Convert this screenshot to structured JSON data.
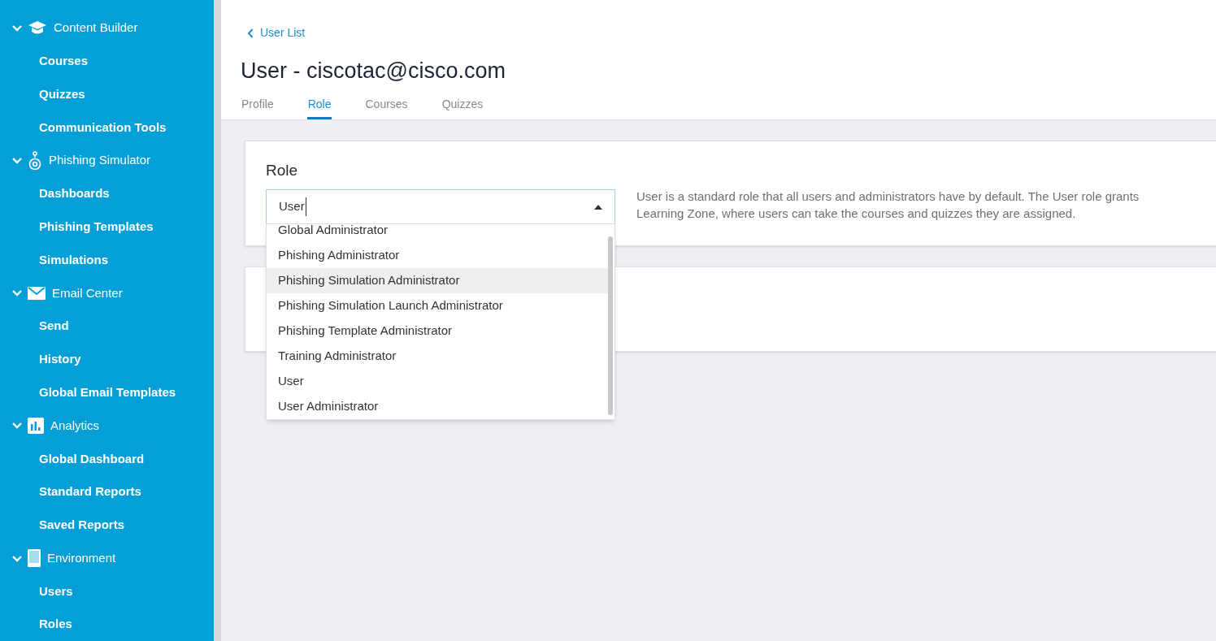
{
  "sidebar": {
    "groups": [
      {
        "label": "Content Builder",
        "expanded": true,
        "items": [
          "Courses",
          "Quizzes",
          "Communication Tools"
        ]
      },
      {
        "label": "Phishing Simulator",
        "expanded": true,
        "items": [
          "Dashboards",
          "Phishing Templates",
          "Simulations"
        ]
      },
      {
        "label": "Email Center",
        "expanded": true,
        "items": [
          "Send",
          "History",
          "Global Email Templates"
        ]
      },
      {
        "label": "Analytics",
        "expanded": true,
        "items": [
          "Global Dashboard",
          "Standard Reports",
          "Saved Reports"
        ]
      },
      {
        "label": "Environment",
        "expanded": true,
        "items": [
          "Users",
          "Roles"
        ]
      }
    ]
  },
  "back_link": "User List",
  "page_title": "User - ciscotac@cisco.com",
  "tabs": [
    {
      "label": "Profile",
      "selected": false
    },
    {
      "label": "Role",
      "selected": true
    },
    {
      "label": "Courses",
      "selected": false
    },
    {
      "label": "Quizzes",
      "selected": false
    }
  ],
  "role_card": {
    "title": "Role",
    "select": {
      "value": "User",
      "expanded": true
    },
    "description": "User is a standard role that all users and administrators have by default. The User role grants Learning Zone, where users can take the courses and quizzes they are assigned.",
    "options": [
      {
        "label": "Global Administrator",
        "selected": false
      },
      {
        "label": "Phishing Administrator",
        "selected": false
      },
      {
        "label": "Phishing Simulation Administrator",
        "selected": true
      },
      {
        "label": "Phishing Simulation Launch Administrator",
        "selected": false
      },
      {
        "label": "Phishing Template Administrator",
        "selected": false
      },
      {
        "label": "Training Administrator",
        "selected": false
      },
      {
        "label": "User",
        "selected": false
      },
      {
        "label": "User Administrator",
        "selected": false
      }
    ]
  }
}
